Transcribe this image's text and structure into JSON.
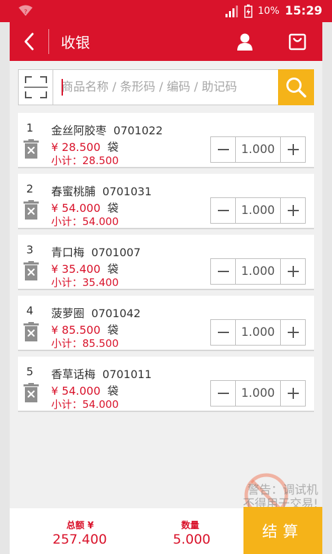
{
  "status_bar": {
    "battery": "10%",
    "time": "15:29"
  },
  "header": {
    "title": "收银"
  },
  "search": {
    "placeholder": "商品名称 / 条形码 / 编码 / 助记码",
    "value": ""
  },
  "items": [
    {
      "index": "1",
      "name": "金丝阿胶枣",
      "code": "0701022",
      "price": "¥ 28.500",
      "unit": "袋",
      "subtotal": "小计：28.500",
      "quantity": "1.000"
    },
    {
      "index": "2",
      "name": "春蜜桃脯",
      "code": "0701031",
      "price": "¥ 54.000",
      "unit": "袋",
      "subtotal": "小计：54.000",
      "quantity": "1.000"
    },
    {
      "index": "3",
      "name": "青口梅",
      "code": "0701007",
      "price": "¥ 35.400",
      "unit": "袋",
      "subtotal": "小计：35.400",
      "quantity": "1.000"
    },
    {
      "index": "4",
      "name": "菠萝圈",
      "code": "0701042",
      "price": "¥ 85.500",
      "unit": "袋",
      "subtotal": "小计：85.500",
      "quantity": "1.000"
    },
    {
      "index": "5",
      "name": "香草话梅",
      "code": "0701011",
      "price": "¥ 54.000",
      "unit": "袋",
      "subtotal": "小计：54.000",
      "quantity": "1.000"
    }
  ],
  "watermark": {
    "line1": "警告：调试机",
    "line2": "不得用于交易!"
  },
  "footer": {
    "total_label": "总额 ¥",
    "total_value": "257.400",
    "qty_label": "数量",
    "qty_value": "5.000",
    "checkout_label": "结算"
  },
  "colors": {
    "brand_red": "#d9132b",
    "accent_yellow": "#f5b319"
  }
}
